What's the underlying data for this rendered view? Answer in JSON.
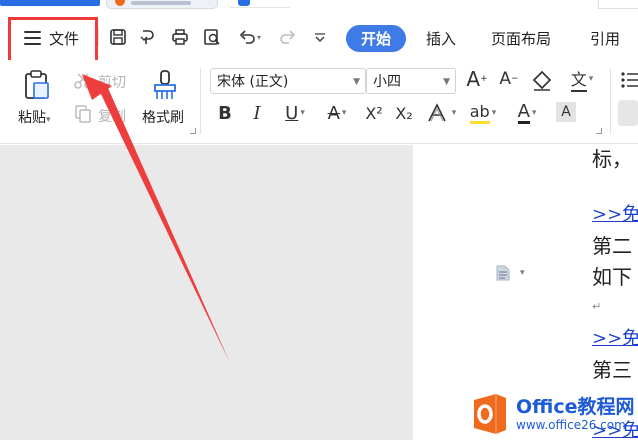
{
  "menubar": {
    "file_label": "文件",
    "tabs": [
      "开始",
      "插入",
      "页面布局",
      "引用"
    ]
  },
  "ribbon": {
    "paste_label": "粘贴",
    "cut_label": "剪切",
    "copy_label": "复制",
    "format_painter_label": "格式刷",
    "font_name": "宋体 (正文)",
    "font_size": "小四",
    "bold": "B",
    "italic": "I",
    "underline": "U",
    "strike": "A",
    "superscript": "X²",
    "subscript": "X₂",
    "grow_font": "A",
    "shrink_font": "A",
    "phonetic": "文"
  },
  "document": {
    "lines": [
      {
        "kind": "text",
        "text": "标，"
      },
      {
        "kind": "link",
        "text": ">>免"
      },
      {
        "kind": "text",
        "text": "第二"
      },
      {
        "kind": "text",
        "text": "如下"
      },
      {
        "kind": "mark",
        "text": "↵"
      },
      {
        "kind": "link",
        "text": ">>免"
      },
      {
        "kind": "text",
        "text": "第三"
      },
      {
        "kind": "link",
        "text": ">>免"
      }
    ]
  },
  "watermark": {
    "title": "Office教程网",
    "url": "www.office26.com"
  },
  "colors": {
    "accent": "#3f7be6",
    "highlight_box": "#ef3b3b",
    "arrow": "#ee3d3d",
    "link": "#1a3fd0",
    "watermark": "#1d5bd6",
    "logo": "#f06a1e"
  }
}
